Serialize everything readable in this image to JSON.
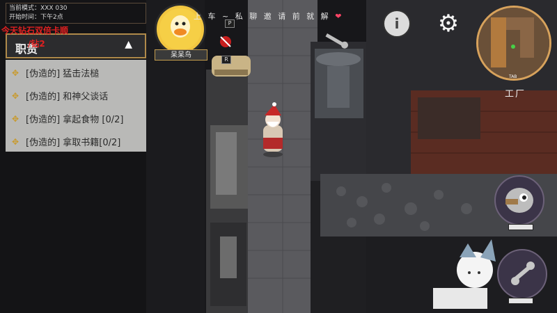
{
  "top_info": {
    "line1": "当前模式：XXX 030",
    "line2": "开始时间：下午2点"
  },
  "promo": {
    "line1": "今天钻石双倍卡顺",
    "line2": "/钻2"
  },
  "duties": {
    "title": "职责",
    "toggle": "▲",
    "items": [
      {
        "prefix": "[伪造的]",
        "label": "猛击法槌"
      },
      {
        "prefix": "[伪造的]",
        "label": "和神父谈话"
      },
      {
        "prefix": "[伪造的]",
        "label": "拿起食物 [0/2]"
      },
      {
        "prefix": "[伪造的]",
        "label": "拿取书籍[0/2]"
      }
    ]
  },
  "player": {
    "name": "呆呆鸟"
  },
  "banner": {
    "text": "上 车 ~ 私 聊 邀 请 前 就 解",
    "heart": "❤"
  },
  "signs": {
    "p": "P",
    "r": "R"
  },
  "buttons": {
    "info_glyph": "i",
    "settings_glyph": "⚙"
  },
  "minimap": {
    "location": "工厂",
    "bottom_label": "TAB"
  },
  "colors": {
    "accent_gold": "#d7a25c",
    "promo_red": "#e02020",
    "duty_dot": "#c89a2c"
  }
}
